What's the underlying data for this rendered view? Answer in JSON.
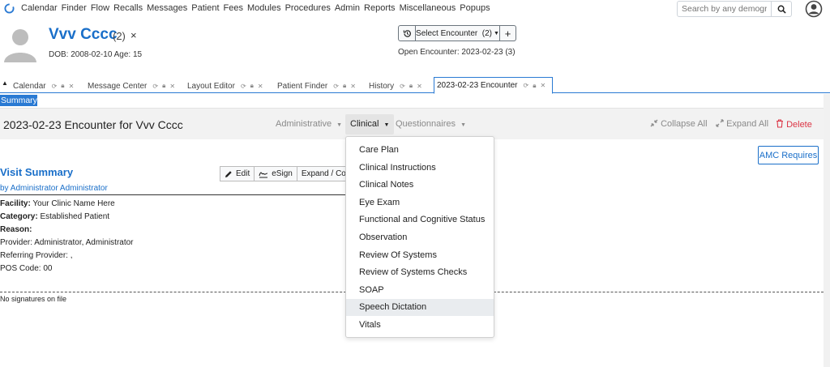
{
  "nav": {
    "menu": [
      "Calendar",
      "Finder",
      "Flow",
      "Recalls",
      "Messages",
      "Patient",
      "Fees",
      "Modules",
      "Procedures",
      "Admin",
      "Reports",
      "Miscellaneous",
      "Popups"
    ],
    "search_placeholder": "Search by any demograph"
  },
  "patient": {
    "name": "Vvv Cccc",
    "count": "(2)",
    "close": "×",
    "dob_line": "DOB: 2008-02-10 Age: 15"
  },
  "encounter_select": {
    "label": "Select Encounter",
    "count": "(2)",
    "plus": "+",
    "open": "Open Encounter: 2023-02-23 (3)"
  },
  "tabs": [
    {
      "label": "Calendar"
    },
    {
      "label": "Message Center"
    },
    {
      "label": "Layout Editor"
    },
    {
      "label": "Patient Finder"
    },
    {
      "label": "History"
    },
    {
      "label": "2023-02-23 Encounter",
      "active": true
    }
  ],
  "summary_tab": "Summary",
  "encounter": {
    "title": "2023-02-23 Encounter for Vvv Cccc",
    "menus": [
      "Administrative",
      "Clinical",
      "Questionnaires"
    ],
    "collapse_all": "Collapse All",
    "expand_all": "Expand All",
    "delete": "Delete"
  },
  "clinical_menu": {
    "items": [
      "Care Plan",
      "Clinical Instructions",
      "Clinical Notes",
      "Eye Exam",
      "Functional and Cognitive Status",
      "Observation",
      "Review Of Systems",
      "Review of Systems Checks",
      "SOAP",
      "Speech Dictation",
      "Vitals"
    ],
    "highlighted": "Speech Dictation"
  },
  "visit_summary": {
    "amc": "AMC Requires",
    "title": "Visit Summary",
    "by": "by Administrator Administrator",
    "edit": "Edit",
    "esign": "eSign",
    "expand": "Expand / Colla",
    "facility_label": "Facility:",
    "facility_value": "Your Clinic Name Here",
    "category_label": "Category:",
    "category_value": "Established Patient",
    "reason_label": "Reason:",
    "provider": "Provider: Administrator, Administrator",
    "referring": "Referring Provider: ,",
    "pos": "POS Code: 00",
    "signatures": "No signatures on file"
  },
  "colors": {
    "accent": "#2a7ad3",
    "link": "#1a6fc9",
    "danger": "#dc3545"
  }
}
